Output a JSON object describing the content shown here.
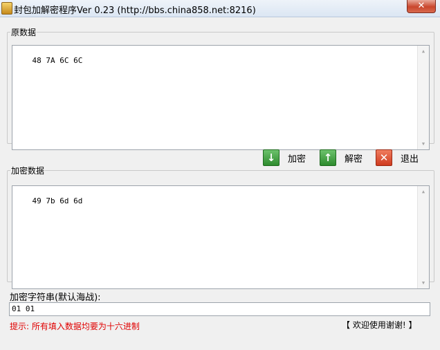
{
  "window": {
    "title": "封包加解密程序Ver 0.23 (http://bbs.china858.net:8216)",
    "close_label": "✕"
  },
  "source_group": {
    "label": "原数据",
    "value": "48 7A 6C 6C"
  },
  "encrypted_group": {
    "label": "加密数据",
    "value": "49 7b 6d 6d"
  },
  "buttons": {
    "encrypt": "加密",
    "decrypt": "解密",
    "exit": "退出"
  },
  "key": {
    "label": "加密字符串(默认海战):",
    "value": "01 01"
  },
  "hint": "提示: 所有填入数据均要为十六进制",
  "thanks": "【 欢迎使用谢谢! 】",
  "icons": {
    "encrypt": "arrow-down-icon",
    "decrypt": "arrow-up-icon",
    "exit": "close-x-icon"
  },
  "colors": {
    "hint": "#e00000",
    "button_green": "#2e8b2e",
    "button_red": "#cf3b1f"
  }
}
